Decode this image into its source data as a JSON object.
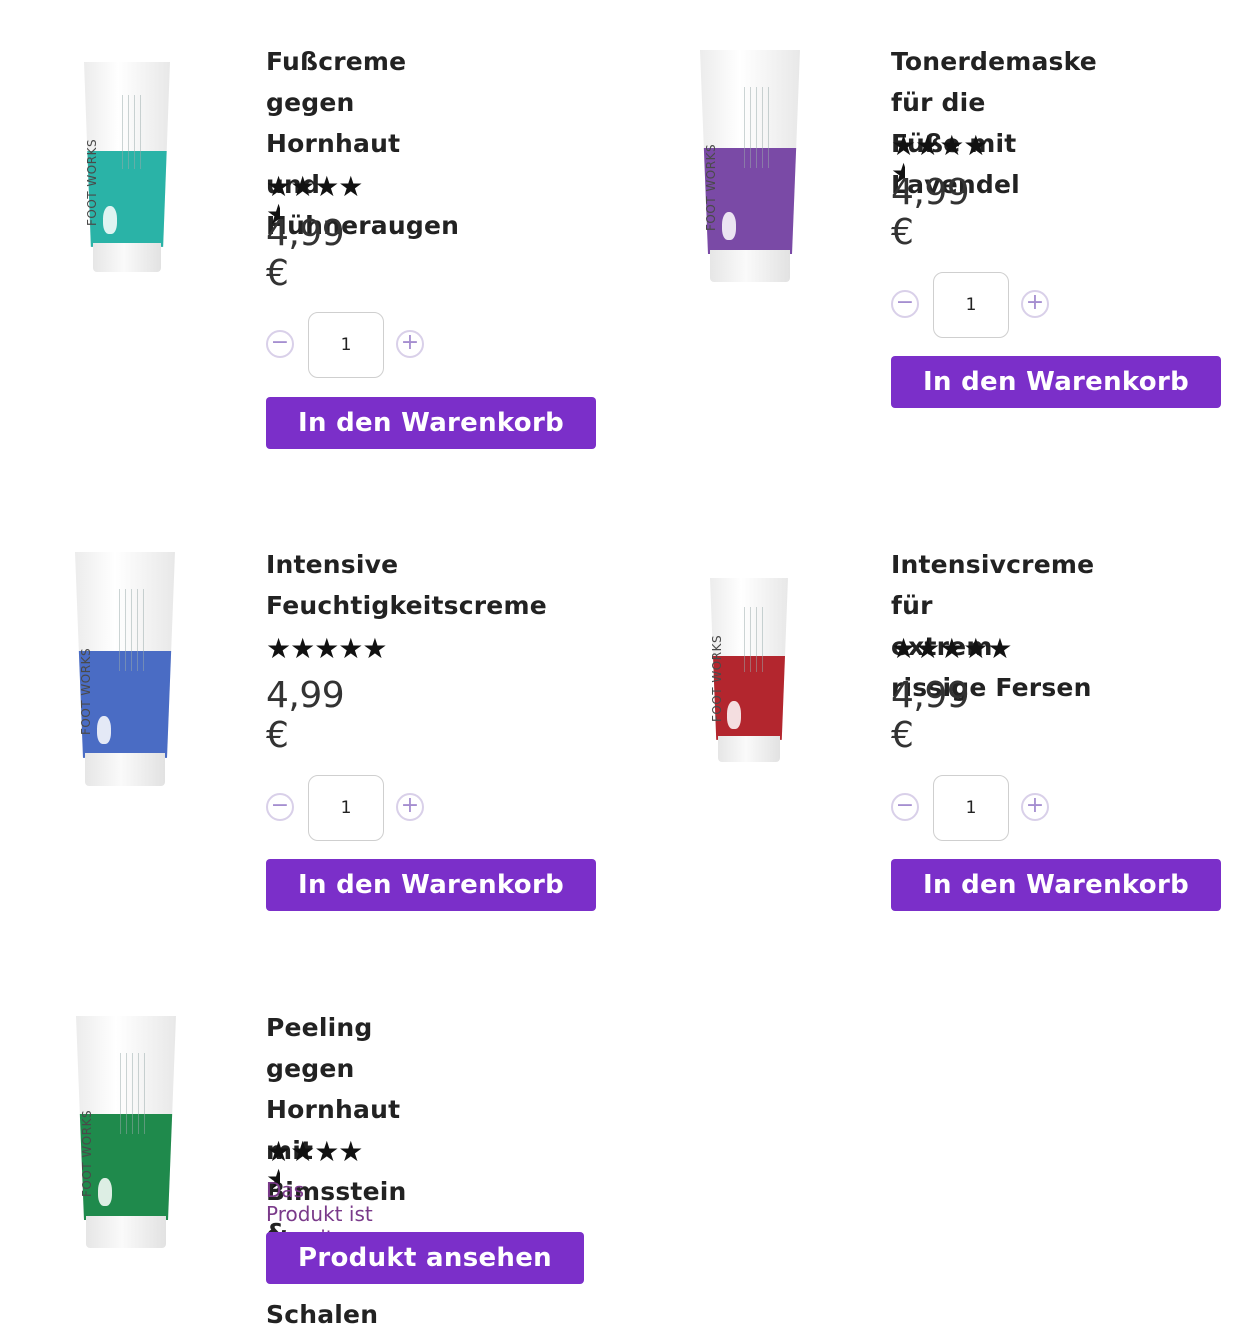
{
  "products": [
    {
      "title_lines": [
        "Fußcreme gegen",
        "Hornhaut und",
        "Hühneraugen"
      ],
      "rating": 4.5,
      "stars_text": "★★★★",
      "price": "4,99 €",
      "quantity": "1",
      "button_label": "In den Warenkorb",
      "tube_color": "#2ab3a7",
      "brand": "FOOT WORKS"
    },
    {
      "title_lines": [
        "Tonerdemaske für die",
        "Füße mit Lavendel"
      ],
      "rating": 4.5,
      "stars_text": "★★★★",
      "price": "4,99 €",
      "quantity": "1",
      "button_label": "In den Warenkorb",
      "tube_color": "#7a4aa6",
      "brand": "FOOT WORKS"
    },
    {
      "title_lines": [
        "Intensive",
        "Feuchtigkeitscreme"
      ],
      "rating": 5,
      "stars_text": "★★★★★",
      "price": "4,99 €",
      "quantity": "1",
      "button_label": "In den Warenkorb",
      "tube_color": "#4a6cc4",
      "brand": "FOOT WORKS"
    },
    {
      "title_lines": [
        "Intensivcreme für",
        "extrem rissige Fersen"
      ],
      "rating": 5,
      "stars_text": "★★★★★",
      "price": "4,99 €",
      "quantity": "1",
      "button_label": "In den Warenkorb",
      "tube_color": "#b3262e",
      "brand": "FOOT WORKS"
    },
    {
      "title_lines": [
        "Peeling gegen Hornhaut",
        "mit Bimsstein &",
        "Walnuss-Schalen"
      ],
      "rating": 4.5,
      "stars_text": "★★★★",
      "status": "Das Produkt ist zurzeit ausverkauft",
      "button_label": "Produkt ansehen",
      "tube_color": "#1f8a4c",
      "brand": "FOOT WORKS"
    }
  ],
  "icons": {
    "minus": "minus-icon",
    "plus": "plus-icon",
    "star": "star-icon"
  },
  "colors": {
    "accent": "#7b2fc9",
    "sold_out_text": "#7a3a8a"
  }
}
